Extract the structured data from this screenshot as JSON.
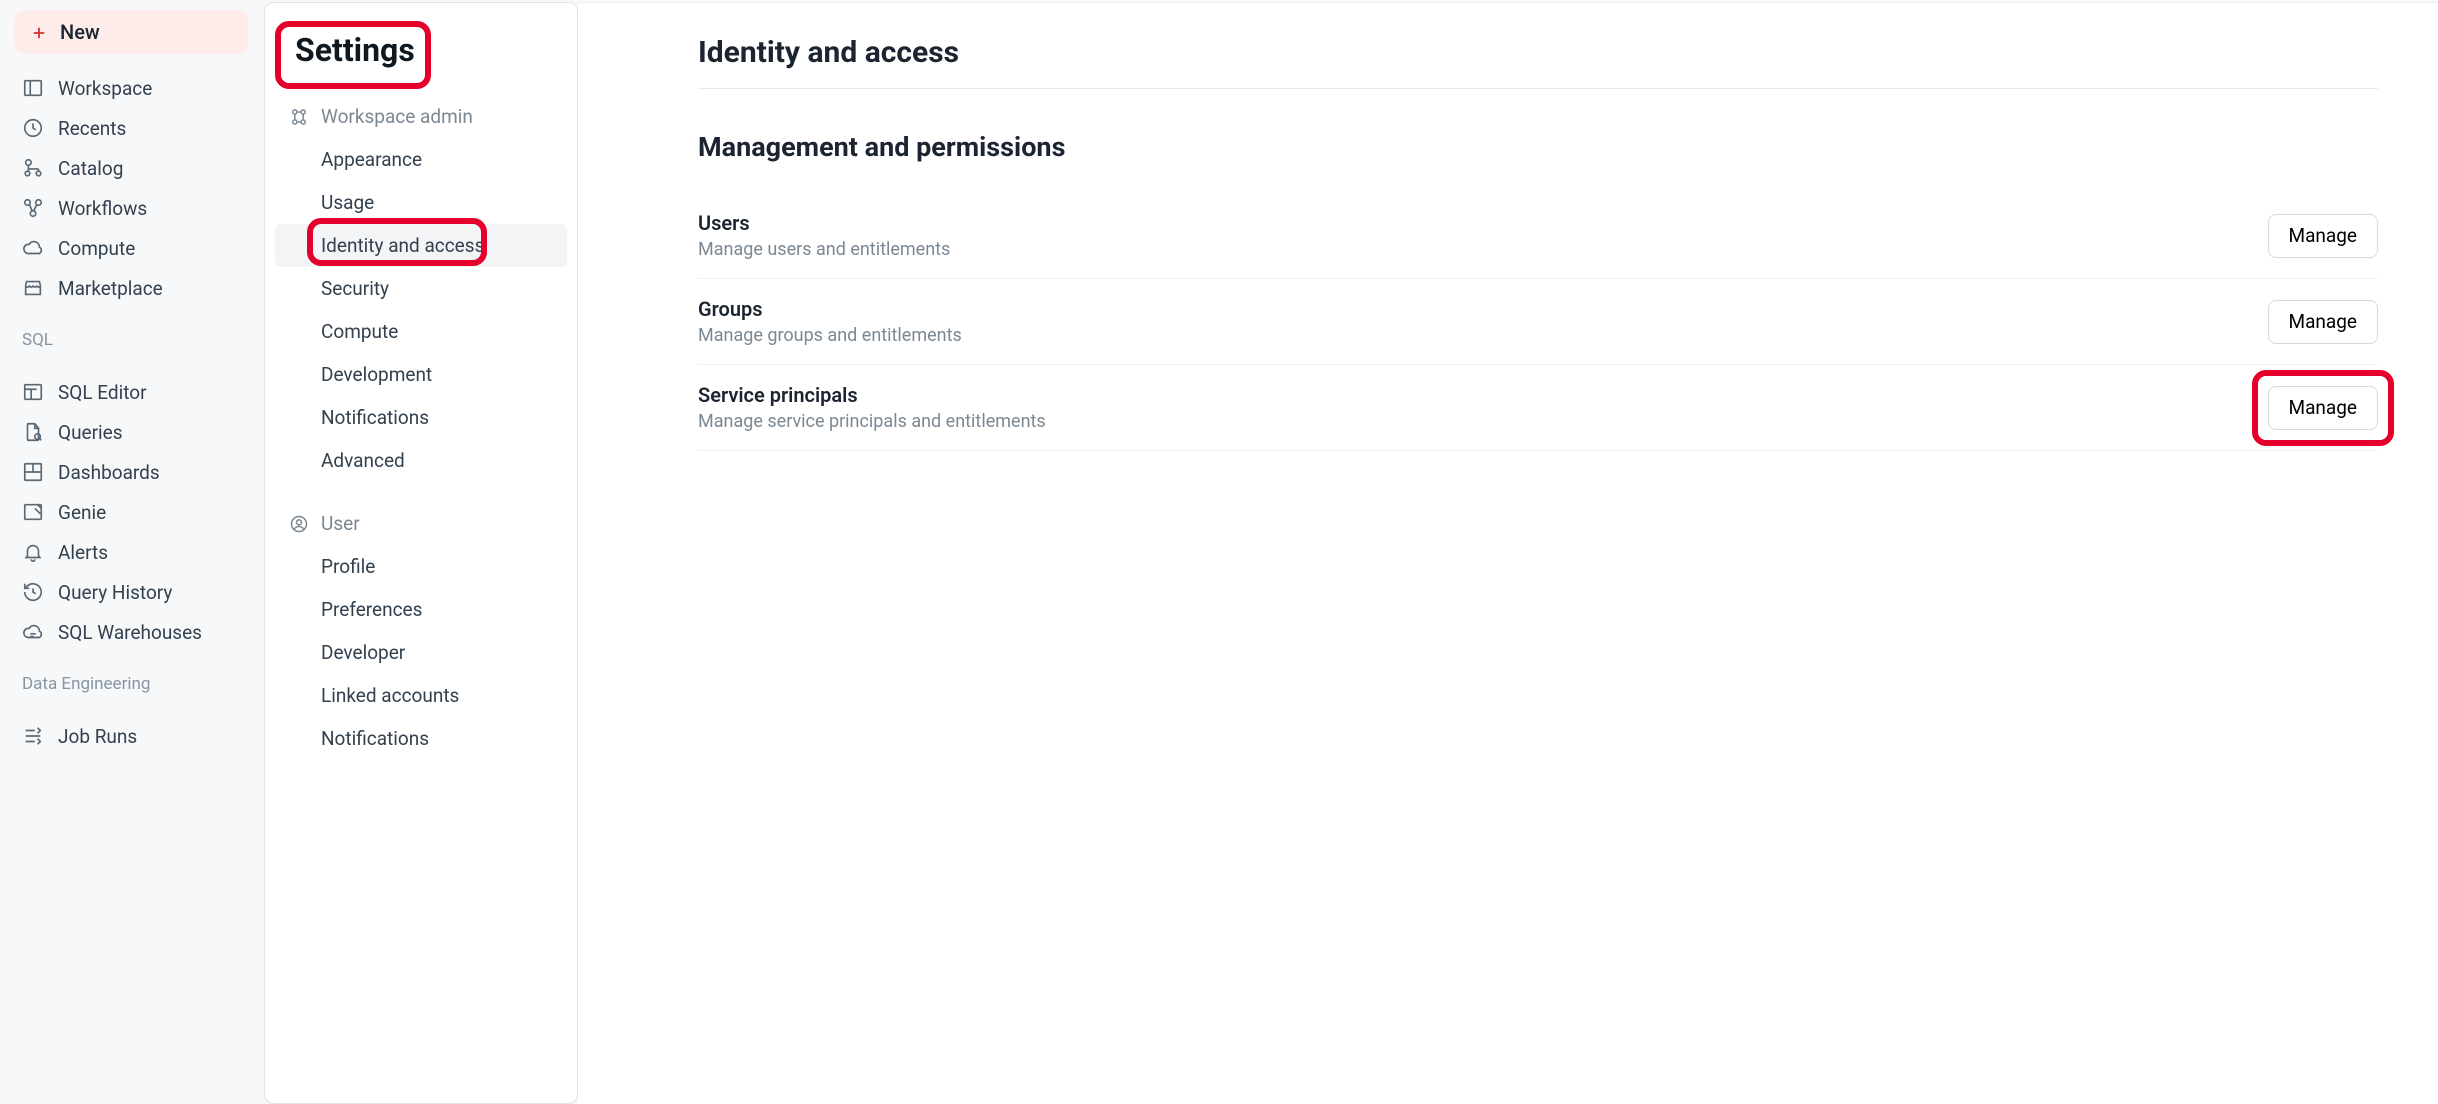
{
  "new_button_label": "New",
  "global_nav": {
    "main": [
      {
        "key": "workspace",
        "label": "Workspace"
      },
      {
        "key": "recents",
        "label": "Recents"
      },
      {
        "key": "catalog",
        "label": "Catalog"
      },
      {
        "key": "workflows",
        "label": "Workflows"
      },
      {
        "key": "compute",
        "label": "Compute"
      },
      {
        "key": "marketplace",
        "label": "Marketplace"
      }
    ],
    "sql_label": "SQL",
    "sql": [
      {
        "key": "sql-editor",
        "label": "SQL Editor"
      },
      {
        "key": "queries",
        "label": "Queries"
      },
      {
        "key": "dashboards",
        "label": "Dashboards"
      },
      {
        "key": "genie",
        "label": "Genie"
      },
      {
        "key": "alerts",
        "label": "Alerts"
      },
      {
        "key": "query-history",
        "label": "Query History"
      },
      {
        "key": "sql-warehouses",
        "label": "SQL Warehouses"
      }
    ],
    "de_label": "Data Engineering",
    "de": [
      {
        "key": "job-runs",
        "label": "Job Runs"
      }
    ]
  },
  "settings": {
    "title": "Settings",
    "workspace_admin_label": "Workspace admin",
    "wadmin_items": [
      {
        "key": "appearance",
        "label": "Appearance"
      },
      {
        "key": "usage",
        "label": "Usage"
      },
      {
        "key": "identity-and-access",
        "label": "Identity and access",
        "active": true
      },
      {
        "key": "security",
        "label": "Security"
      },
      {
        "key": "compute",
        "label": "Compute"
      },
      {
        "key": "development",
        "label": "Development"
      },
      {
        "key": "notifications",
        "label": "Notifications"
      },
      {
        "key": "advanced",
        "label": "Advanced"
      }
    ],
    "user_label": "User",
    "user_items": [
      {
        "key": "profile",
        "label": "Profile"
      },
      {
        "key": "preferences",
        "label": "Preferences"
      },
      {
        "key": "developer",
        "label": "Developer"
      },
      {
        "key": "linked-accounts",
        "label": "Linked accounts"
      },
      {
        "key": "notifications-u",
        "label": "Notifications"
      }
    ]
  },
  "main": {
    "page_title": "Identity and access",
    "section_title": "Management and permissions",
    "rows": [
      {
        "key": "users",
        "title": "Users",
        "desc": "Manage users and entitlements",
        "btn": "Manage"
      },
      {
        "key": "groups",
        "title": "Groups",
        "desc": "Manage groups and entitlements",
        "btn": "Manage"
      },
      {
        "key": "service-principals",
        "title": "Service principals",
        "desc": "Manage service principals and entitlements",
        "btn": "Manage",
        "highlighted": true
      }
    ]
  }
}
